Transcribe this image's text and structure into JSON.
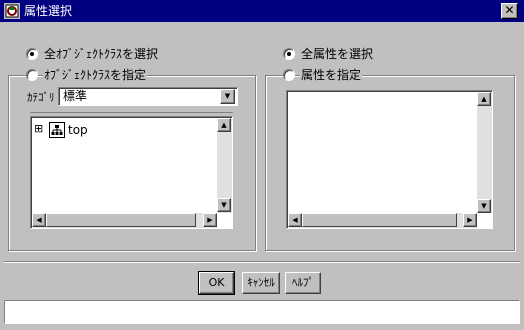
{
  "window": {
    "title": "属性選択",
    "close_glyph": "✕"
  },
  "left": {
    "radio_all_classes": {
      "label": "全ｵﾌﾞｼﾞｪｸﾄｸﾗｽを選択",
      "selected": true
    },
    "radio_specify_classes": {
      "label": "ｵﾌﾞｼﾞｪｸﾄｸﾗｽを指定",
      "selected": false
    },
    "category": {
      "label": "ｶﾃｺﾞﾘ",
      "value": "標準"
    },
    "tree": {
      "root_label": "top",
      "expander_glyph": "⊞",
      "icon": "hierarchy-icon"
    }
  },
  "right": {
    "radio_all_attributes": {
      "label": "全属性を選択",
      "selected": true
    },
    "radio_specify_attributes": {
      "label": "属性を指定",
      "selected": false
    }
  },
  "buttons": {
    "ok": "OK",
    "cancel": "ｷｬﾝｾﾙ",
    "help": "ﾍﾙﾌﾟ"
  },
  "colors": {
    "titlebar": "#000080",
    "face": "#c0c0c0"
  }
}
